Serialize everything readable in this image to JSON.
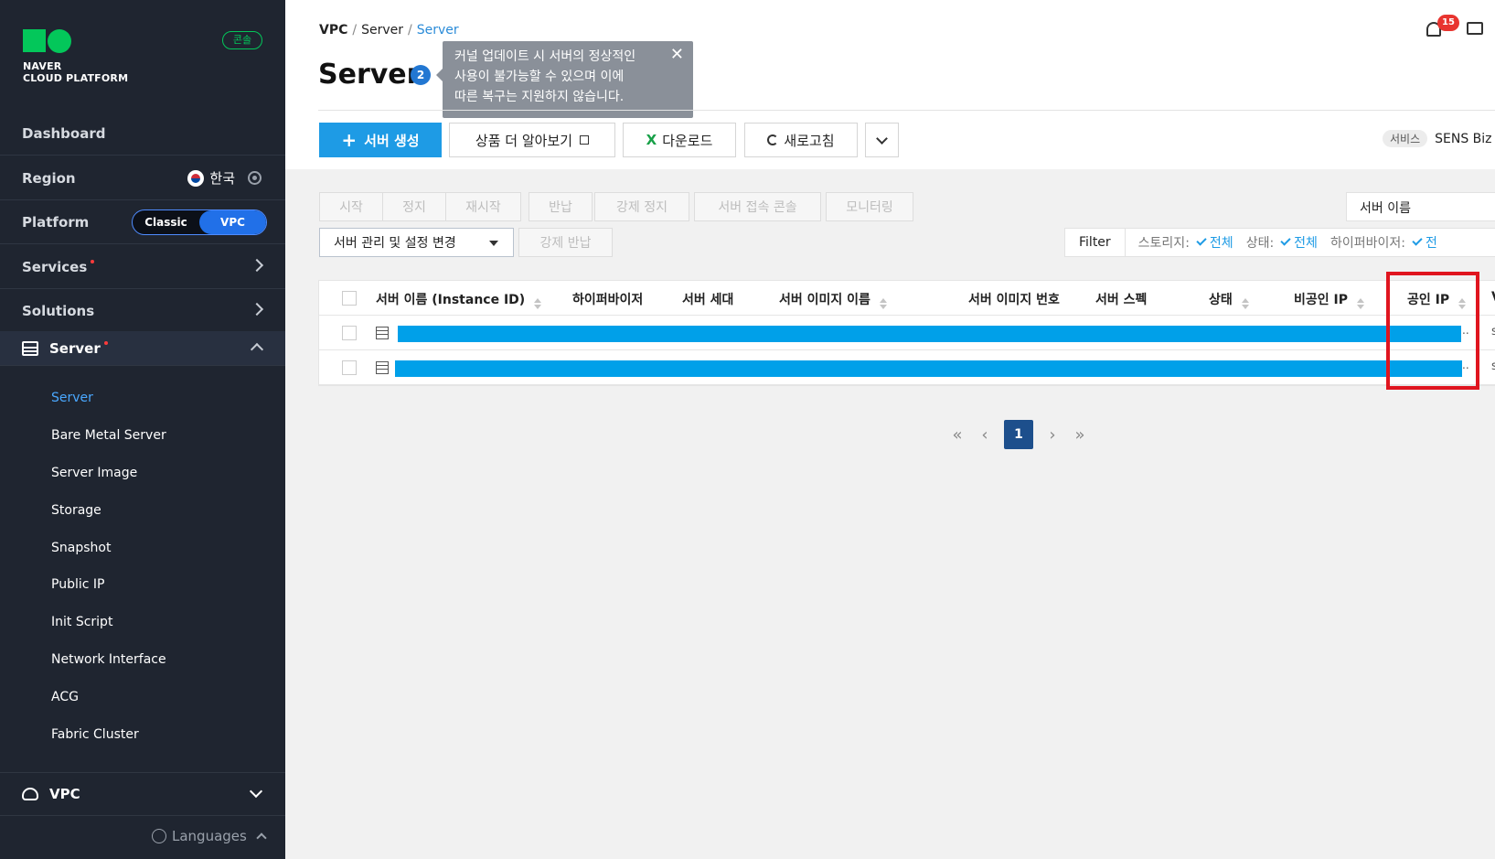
{
  "sidebar": {
    "logo_line1": "NAVER",
    "logo_line2": "CLOUD PLATFORM",
    "console_badge": "콘솔",
    "dashboard": "Dashboard",
    "region_label": "Region",
    "region_value": "한국",
    "platform_label": "Platform",
    "platform_options": [
      "Classic",
      "VPC"
    ],
    "platform_selected": "VPC",
    "services": "Services",
    "solutions": "Solutions",
    "server": "Server",
    "submenu": [
      "Server",
      "Bare Metal Server",
      "Server Image",
      "Storage",
      "Snapshot",
      "Public IP",
      "Init Script",
      "Network Interface",
      "ACG",
      "Fabric Cluster"
    ],
    "submenu_active": "Server",
    "vpc": "VPC",
    "languages": "Languages"
  },
  "header": {
    "breadcrumb": [
      "VPC",
      "Server",
      "Server"
    ],
    "title": "Server",
    "count": "2",
    "tooltip_lines": [
      "커널 업데이트 시 서버의 정상적인",
      "사용이 불가능할 수 있으며 이에",
      "따른 복구는 지원하지 않습니다."
    ],
    "tooltip_close": "✕",
    "notifications": "15"
  },
  "toolbar": {
    "create": "서버 생성",
    "learn_more": "상품 더 알아보기",
    "download": "다운로드",
    "refresh": "새로고침",
    "service_tag": "서비스",
    "service_name": "SENS Biz I"
  },
  "actions": {
    "start": "시작",
    "stop": "정지",
    "restart": "재시작",
    "return": "반납",
    "force_stop": "강제 정지",
    "console": "서버 접속 콘솔",
    "monitoring": "모니터링",
    "manage": "서버 관리 및 설정 변경",
    "force_return": "강제 반납",
    "search_placeholder": "서버 이름"
  },
  "filter": {
    "label": "Filter",
    "items": [
      {
        "name": "스토리지:",
        "value": "전체"
      },
      {
        "name": "상태:",
        "value": "전체"
      },
      {
        "name": "하이퍼바이저:",
        "value": "전"
      }
    ]
  },
  "table": {
    "columns": [
      "서버 이름 (Instance ID)",
      "하이퍼바이저",
      "서버 세대",
      "서버 이미지 이름",
      "서버 이미지 번호",
      "서버 스펙",
      "상태",
      "비공인 IP",
      "공인 IP",
      "V"
    ],
    "rows": [
      {
        "ellipsis": "..",
        "trailing": "s"
      },
      {
        "ellipsis": "..",
        "trailing": "s"
      }
    ]
  },
  "pagination": {
    "current": "1",
    "first": "«",
    "prev": "‹",
    "next": "›",
    "last": "»"
  }
}
